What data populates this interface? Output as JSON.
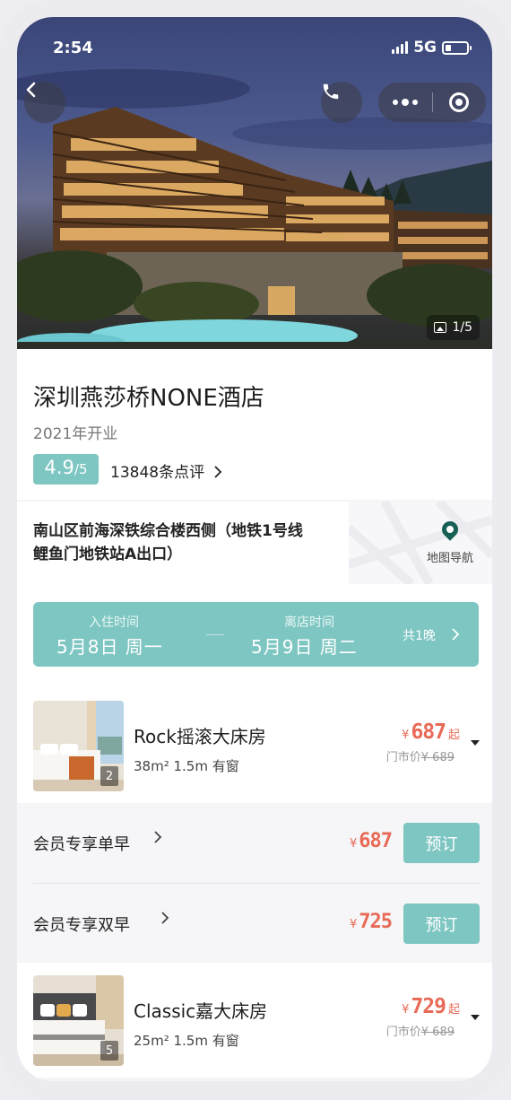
{
  "status": {
    "time": "2:54",
    "network": "5G"
  },
  "hero": {
    "photo_count": "1/5"
  },
  "hotel": {
    "name": "深圳燕莎桥NONE酒店",
    "opened": "2021年开业",
    "score": "4.9",
    "score_max": "/5",
    "reviews": "13848条点评"
  },
  "address": {
    "line1": "南山区前海深铁综合楼西侧（地铁1号线",
    "line2": "鲤鱼门地铁站A出口）",
    "nav_label": "地图导航"
  },
  "dates": {
    "checkin_label": "入住时间",
    "checkin_value": "5月8日  周一",
    "checkout_label": "离店时间",
    "checkout_value": "5月9日  周二",
    "nights": "共1晚"
  },
  "rooms": [
    {
      "name": "Rock摇滚大床房",
      "specs": "38m² 1.5m  有窗",
      "image_count": "2",
      "currency": "¥",
      "price": "687",
      "price_suffix": "起",
      "market_label": "门市价",
      "market_price": "¥ 689",
      "rates": [
        {
          "name": "会员专享单早",
          "currency": "¥",
          "price": "687",
          "book": "预订"
        },
        {
          "name": "会员专享双早",
          "currency": "¥",
          "price": "725",
          "book": "预订"
        }
      ]
    },
    {
      "name": "Classic嘉大床房",
      "specs": "25m² 1.5m  有窗",
      "image_count": "5",
      "currency": "¥",
      "price": "729",
      "price_suffix": "起",
      "market_label": "门市价",
      "market_price": "¥ 689"
    }
  ],
  "colors": {
    "accent": "#7ec6c2",
    "price": "#e86a56",
    "pin": "#155f55"
  },
  "icons": [
    "back-chevron-icon",
    "phone-icon",
    "more-dots-icon",
    "target-icon",
    "image-icon",
    "map-pin-icon",
    "chevron-right-icon",
    "caret-down-icon"
  ]
}
